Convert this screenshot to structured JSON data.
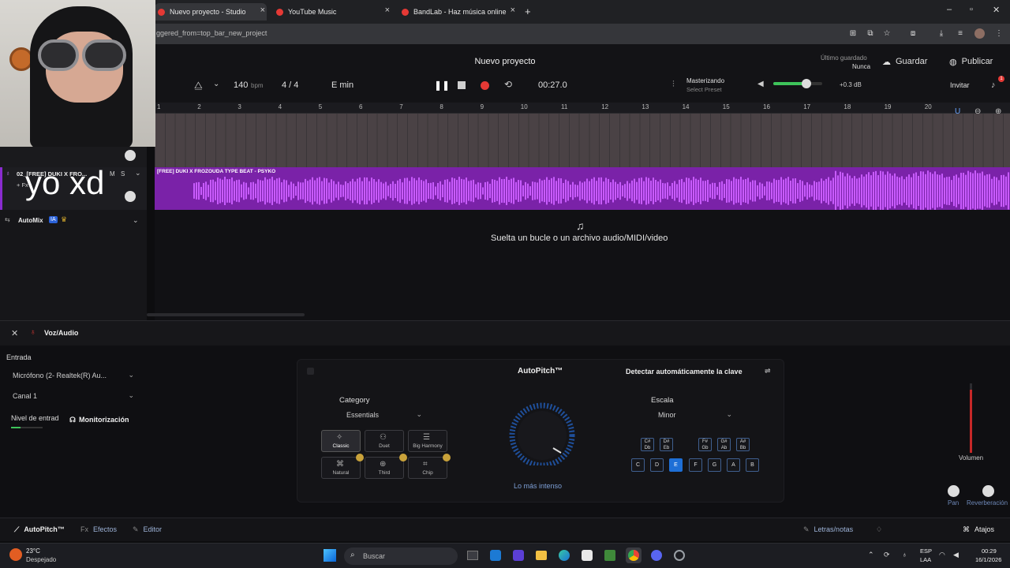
{
  "browser": {
    "tabs": [
      {
        "title": "Nuevo proyecto - Studio"
      },
      {
        "title": "YouTube Music"
      },
      {
        "title": "BandLab - Haz música online"
      }
    ],
    "url": "ggered_from=top_bar_new_project"
  },
  "header": {
    "project_title": "Nuevo proyecto",
    "last_saved_label": "Último guardado",
    "last_saved_value": "Nunca",
    "save": "Guardar",
    "publish": "Publicar",
    "invite": "Invitar",
    "notif_count": "1",
    "tempo": "140",
    "tempo_unit": "bpm",
    "time_sig": "4 / 4",
    "key": "E min",
    "time": "00:27.0",
    "mastering_label": "Masterizando",
    "mastering_preset": "Select Preset",
    "master_gain": "+0.3 dB"
  },
  "ruler": [
    "1",
    "2",
    "3",
    "4",
    "5",
    "6",
    "7",
    "8",
    "9",
    "10",
    "11",
    "12",
    "13",
    "14",
    "15",
    "16",
    "17",
    "18",
    "19",
    "20"
  ],
  "tracks": [
    {
      "name": "02_[FREE] DUKI X FRO...",
      "fx": "+ Fx",
      "mute": "M",
      "solo": "S"
    },
    {
      "name": "AutoMix",
      "badge": "IA"
    }
  ],
  "clip": {
    "name": "[FREE] DUKI X FROZOUDA TYPE BEAT - PSYKO"
  },
  "drop_hint": "Suelta un bucle o un archivo audio/MIDI/video",
  "webcam_overlay": "yo xd",
  "panel": {
    "title": "Voz/Audio",
    "input_label": "Entrada",
    "input_device": "Micrófono (2- Realtek(R) Au...",
    "channel": "Canal 1",
    "level_label": "Nivel de entrad",
    "monitor": "Monitorización",
    "autopitch_title": "AutoPitch™",
    "detect_key": "Detectar automáticamente la clave",
    "category_label": "Category",
    "category_value": "Essentials",
    "presets": [
      "Classic",
      "Duet",
      "Big Harmony",
      "Natural",
      "Third",
      "Chip"
    ],
    "knob_label": "Lo más intenso",
    "scale_label": "Escala",
    "scale_value": "Minor",
    "sharp_keys": [
      "C# Db",
      "D# Eb",
      "F# Gb",
      "G# Ab",
      "A# Bb"
    ],
    "keys": [
      "C",
      "D",
      "E",
      "F",
      "G",
      "A",
      "B"
    ],
    "selected_key": "E",
    "volume": "Volumen",
    "pan": "Pan",
    "reverb": "Reverberación",
    "pan_lr": "L R"
  },
  "footer": {
    "autopitch": "AutoPitch™",
    "effects": "Efectos",
    "editor": "Editor",
    "lyrics": "Letras/notas",
    "shortcuts": "Atajos"
  },
  "taskbar": {
    "temp": "23°C",
    "weather": "Despejado",
    "search": "Buscar",
    "lang1": "ESP",
    "lang2": "LAA",
    "time": "00:29",
    "date": "16/1/2026"
  },
  "colors": {
    "accent_purple": "#8a2bd0",
    "record": "#e53935",
    "key_selected": "#1e6fd6"
  }
}
